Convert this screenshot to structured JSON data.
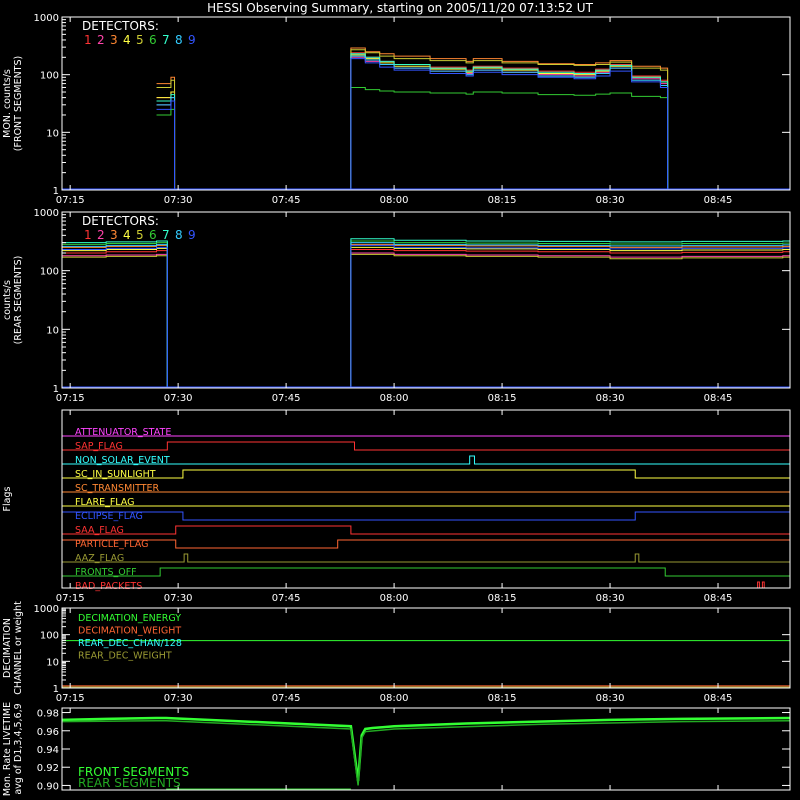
{
  "title": "HESSI Observing Summary, starting on 2005/11/20 07:13:52 UT",
  "colors": {
    "background": "#000000",
    "axes": "#ffffff",
    "det1": "#ff3333",
    "det2": "#ff44aa",
    "det3": "#ff8833",
    "det4": "#ffff44",
    "det5": "#cccc33",
    "det6": "#33cc33",
    "det7": "#33ffcc",
    "det8": "#33ccff",
    "det9": "#3355ff"
  },
  "chart_data": [
    {
      "type": "line",
      "name": "front",
      "ylabel": [
        "MON. counts/s",
        "(FRONT SEGMENTS)"
      ],
      "yscale": "log",
      "ylim": [
        1,
        1000
      ],
      "yticks": [
        "1",
        "10",
        "100",
        "1000"
      ],
      "xlim": [
        "07:13:52",
        "08:55:00"
      ],
      "xticks": [
        "07:15",
        "07:30",
        "07:45",
        "08:00",
        "08:15",
        "08:30",
        "08:45"
      ],
      "legend": {
        "heading": "DETECTORS:",
        "labels": [
          "1",
          "2",
          "3",
          "4",
          "5",
          "6",
          "7",
          "8",
          "9"
        ],
        "placement": "top-left"
      },
      "x": [
        "07:27",
        "07:29",
        "07:54",
        "07:56",
        "07:58",
        "08:00",
        "08:05",
        "08:10",
        "08:11",
        "08:15",
        "08:20",
        "08:25",
        "08:28",
        "08:30",
        "08:33",
        "08:37"
      ],
      "series": [
        {
          "name": "1",
          "values": [
            40,
            50,
            240,
            200,
            170,
            150,
            135,
            120,
            140,
            130,
            115,
            110,
            125,
            150,
            95,
            80
          ]
        },
        {
          "name": "2",
          "values": [
            30,
            40,
            200,
            170,
            150,
            130,
            115,
            105,
            120,
            110,
            100,
            95,
            110,
            130,
            85,
            70
          ]
        },
        {
          "name": "3",
          "values": [
            70,
            90,
            290,
            250,
            230,
            210,
            190,
            170,
            190,
            170,
            155,
            150,
            160,
            175,
            140,
            130
          ]
        },
        {
          "name": "4",
          "values": [
            40,
            50,
            220,
            190,
            160,
            140,
            125,
            110,
            130,
            120,
            105,
            100,
            115,
            140,
            90,
            75
          ]
        },
        {
          "name": "5",
          "values": [
            60,
            80,
            270,
            240,
            210,
            190,
            175,
            160,
            175,
            160,
            150,
            145,
            150,
            165,
            130,
            120
          ]
        },
        {
          "name": "6",
          "values": [
            20,
            25,
            60,
            55,
            52,
            50,
            48,
            46,
            50,
            48,
            45,
            44,
            46,
            48,
            42,
            40
          ]
        },
        {
          "name": "7",
          "values": [
            35,
            45,
            230,
            200,
            170,
            150,
            130,
            115,
            135,
            125,
            110,
            105,
            120,
            145,
            90,
            75
          ]
        },
        {
          "name": "8",
          "values": [
            30,
            40,
            210,
            180,
            150,
            130,
            115,
            100,
            120,
            110,
            95,
            90,
            105,
            130,
            80,
            65
          ]
        },
        {
          "name": "9",
          "values": [
            25,
            35,
            190,
            160,
            135,
            120,
            105,
            95,
            110,
            100,
            90,
            85,
            95,
            115,
            75,
            60
          ]
        }
      ]
    },
    {
      "type": "line",
      "name": "rear",
      "ylabel": [
        "counts/s",
        "(REAR SEGMENTS)"
      ],
      "yscale": "log",
      "ylim": [
        1,
        1000
      ],
      "yticks": [
        "1",
        "10",
        "100",
        "1000"
      ],
      "xlim": [
        "07:13:52",
        "08:55:00"
      ],
      "xticks": [
        "07:15",
        "07:30",
        "07:45",
        "08:00",
        "08:15",
        "08:30",
        "08:45"
      ],
      "legend": {
        "heading": "DETECTORS:",
        "labels": [
          "1",
          "2",
          "3",
          "4",
          "5",
          "6",
          "7",
          "8",
          "9"
        ],
        "placement": "top-left"
      },
      "x": [
        "07:14",
        "07:20",
        "07:27",
        "07:54",
        "08:00",
        "08:10",
        "08:20",
        "08:30",
        "08:40",
        "08:54"
      ],
      "series": [
        {
          "name": "1",
          "values": [
            200,
            210,
            220,
            230,
            220,
            215,
            210,
            200,
            205,
            210
          ]
        },
        {
          "name": "2",
          "values": [
            180,
            185,
            190,
            200,
            190,
            185,
            180,
            170,
            175,
            180
          ]
        },
        {
          "name": "3",
          "values": [
            250,
            260,
            270,
            280,
            270,
            265,
            260,
            250,
            255,
            260
          ]
        },
        {
          "name": "4",
          "values": [
            220,
            230,
            240,
            250,
            240,
            235,
            230,
            220,
            225,
            230
          ]
        },
        {
          "name": "5",
          "values": [
            170,
            175,
            180,
            190,
            180,
            175,
            170,
            160,
            165,
            170
          ]
        },
        {
          "name": "6",
          "values": [
            280,
            290,
            300,
            320,
            300,
            295,
            290,
            285,
            290,
            295
          ]
        },
        {
          "name": "7",
          "values": [
            300,
            310,
            320,
            350,
            330,
            320,
            315,
            310,
            315,
            320
          ]
        },
        {
          "name": "8",
          "values": [
            260,
            270,
            280,
            300,
            280,
            275,
            270,
            265,
            270,
            275
          ]
        },
        {
          "name": "9",
          "values": [
            230,
            240,
            250,
            270,
            250,
            245,
            240,
            235,
            240,
            245
          ]
        }
      ]
    },
    {
      "type": "line",
      "name": "flags",
      "ylabel": [
        "Flags"
      ],
      "xlim": [
        "07:13:52",
        "08:55:00"
      ],
      "xticks": [
        "07:15",
        "07:30",
        "07:45",
        "08:00",
        "08:15",
        "08:30",
        "08:45"
      ],
      "flags": [
        {
          "label": "ATTENUATOR_STATE",
          "color": "#ff44ff",
          "segments": []
        },
        {
          "label": "SAP_FLAG",
          "color": "#ff3333",
          "segments": [
            [
              "07:28:30",
              "07:54:30"
            ]
          ]
        },
        {
          "label": "NON_SOLAR_EVENT",
          "color": "#33ffff",
          "segments": [
            [
              "08:10:30",
              "08:11:10"
            ]
          ]
        },
        {
          "label": "SC_IN_SUNLIGHT",
          "color": "#ffff44",
          "segments": [
            [
              "07:30:40",
              "08:33:30"
            ]
          ]
        },
        {
          "label": "SC_TRANSMITTER",
          "color": "#ff8833",
          "segments": []
        },
        {
          "label": "FLARE_FLAG",
          "color": "#ffff44",
          "segments": []
        },
        {
          "label": "ECLIPSE_FLAG",
          "color": "#3355ff",
          "segments": [
            [
              "07:13:52",
              "07:30:40"
            ],
            [
              "08:33:30",
              "08:55:00"
            ]
          ]
        },
        {
          "label": "SAA_FLAG",
          "color": "#ff3333",
          "segments": [
            [
              "07:29:40",
              "07:54:00"
            ]
          ]
        },
        {
          "label": "PARTICLE_FLAG",
          "color": "#ff6633",
          "segments": [
            [
              "07:13:52",
              "07:29:40"
            ],
            [
              "07:52:10",
              "08:55:00"
            ]
          ]
        },
        {
          "label": "AAZ_FLAG",
          "color": "#999933",
          "segments": [
            [
              "07:30:50",
              "07:31:20"
            ],
            [
              "08:33:30",
              "08:34:00"
            ]
          ]
        },
        {
          "label": "FRONTS_OFF",
          "color": "#33cc33",
          "segments": [
            [
              "07:27:30",
              "08:37:40"
            ]
          ]
        },
        {
          "label": "BAD_PACKETS",
          "color": "#ff3333",
          "segments": [
            [
              "08:50:30",
              "08:50:45"
            ],
            [
              "08:51:10",
              "08:51:25"
            ]
          ]
        }
      ]
    },
    {
      "type": "line",
      "name": "decimation",
      "ylabel": [
        "DECIMATION",
        "CHANNEL or weight"
      ],
      "yscale": "log",
      "ylim": [
        1,
        1000
      ],
      "yticks": [
        "1",
        "10",
        "100",
        "1000"
      ],
      "xlim": [
        "07:13:52",
        "08:55:00"
      ],
      "xticks": [
        "07:15",
        "07:30",
        "07:45",
        "08:00",
        "08:15",
        "08:30",
        "08:45"
      ],
      "series": [
        {
          "name": "DECIMATION_ENERGY",
          "color": "#33ff33",
          "values": [
            60,
            60
          ]
        },
        {
          "name": "DECIMATION_WEIGHT",
          "color": "#ff6633",
          "values": [
            1.2,
            1.2
          ]
        },
        {
          "name": "REAR_DEC_CHAN/128",
          "color": "#33ffff",
          "values": [
            1,
            1
          ]
        },
        {
          "name": "REAR_DEC_WEIGHT",
          "color": "#999933",
          "values": [
            1,
            1
          ]
        }
      ],
      "x": [
        "07:13:52",
        "08:55:00"
      ]
    },
    {
      "type": "line",
      "name": "livetime",
      "ylabel": [
        "Mon. Rate LIVETIME",
        "avg of D1,3,4,5,6,9"
      ],
      "ylim": [
        0.895,
        0.985
      ],
      "yticks": [
        "0.90",
        "0.92",
        "0.94",
        "0.96",
        "0.98"
      ],
      "xlim": [
        "07:13:52",
        "08:55:00"
      ],
      "legend": {
        "labels": [
          "FRONT SEGMENTS",
          "REAR SEGMENTS"
        ],
        "placement": "bottom-left"
      },
      "series": [
        {
          "name": "FRONT SEGMENTS",
          "color": "#33ff33",
          "x": [
            "07:13:52",
            "07:20",
            "07:27",
            "07:28:20",
            "07:54:00",
            "07:55:00",
            "07:55:30",
            "07:56:00",
            "07:57",
            "08:00",
            "08:10",
            "08:20",
            "08:30",
            "08:40",
            "08:55"
          ],
          "values": [
            0.972,
            0.973,
            0.974,
            0.974,
            0.965,
            0.905,
            0.955,
            0.962,
            0.963,
            0.965,
            0.968,
            0.97,
            0.972,
            0.973,
            0.974
          ]
        },
        {
          "name": "REAR SEGMENTS",
          "color": "#22aa22",
          "x": [
            "07:13:52",
            "07:27",
            "07:28:20",
            "07:54:00",
            "07:55:00",
            "07:55:30",
            "07:56:00",
            "08:00",
            "08:20",
            "08:40",
            "08:55"
          ],
          "values": [
            0.97,
            0.971,
            0.971,
            0.962,
            0.9,
            0.952,
            0.959,
            0.962,
            0.967,
            0.97,
            0.971
          ]
        }
      ]
    }
  ]
}
